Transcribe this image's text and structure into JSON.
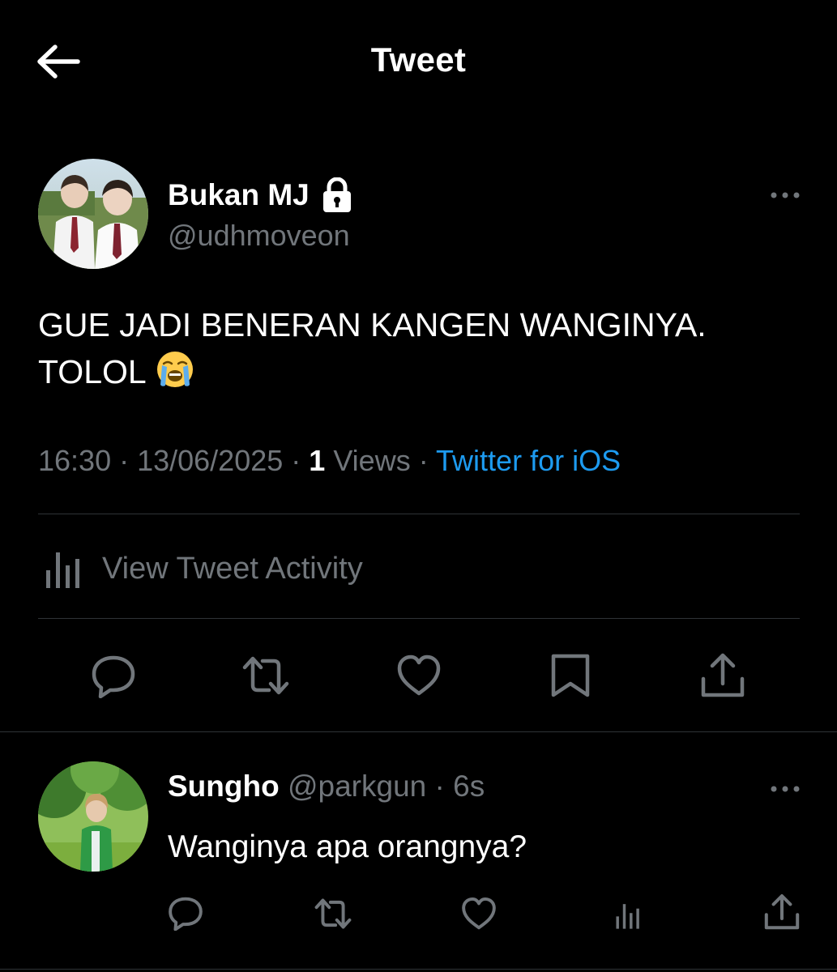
{
  "header": {
    "title": "Tweet",
    "back_icon": "arrow-left-icon"
  },
  "tweet": {
    "author": {
      "name": "Bukan MJ",
      "handle": "@udhmoveon",
      "protected": true
    },
    "text_line1": "GUE JADI BENERAN KANGEN WANGINYA.",
    "text_line2": "TOLOL",
    "emoji": "loudly-crying-face",
    "time": "16:30",
    "sep": " · ",
    "date": "13/06/2025",
    "views_count": "1",
    "views_label": " Views",
    "source": "Twitter for iOS",
    "activity_label": "View Tweet Activity"
  },
  "reply": {
    "name": "Sungho",
    "handle": "@parkgun",
    "age": "6s",
    "text": "Wanginya apa orangnya?"
  },
  "colors": {
    "background": "#000000",
    "text_primary": "#ffffff",
    "text_secondary": "#71767b",
    "link": "#1d9bf0",
    "divider": "#2f3336"
  }
}
